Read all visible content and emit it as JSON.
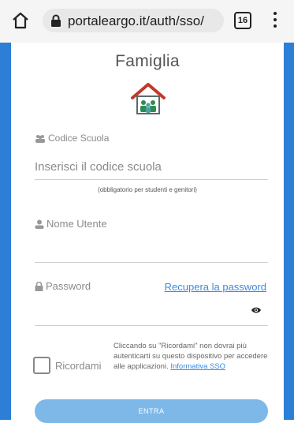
{
  "browser": {
    "url": "portaleargo.it/auth/sso/",
    "tab_count": "16"
  },
  "header": {
    "title": "Famiglia"
  },
  "form": {
    "school_code": {
      "label": "Codice Scuola",
      "placeholder": "Inserisci il codice scuola",
      "hint": "(obbligatorio per studenti e genitori)"
    },
    "username": {
      "label": "Nome Utente",
      "value": ""
    },
    "password": {
      "label": "Password",
      "recover_link": "Recupera la password",
      "value": ""
    },
    "remember": {
      "label": "Ricordami",
      "note": "Cliccando su \"Ricordami\" non dovrai più autenticarti su questo dispositivo per accedere alle applicazioni.",
      "info_link": "Informativa SSO"
    },
    "submit_label": "ENTRA"
  },
  "colors": {
    "accent": "#3a8be0",
    "button": "#7db8e8",
    "side_border": "#2c7fd6"
  }
}
